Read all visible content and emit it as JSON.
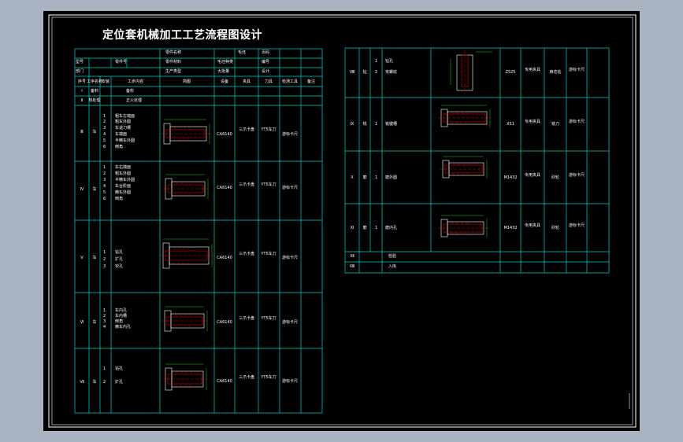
{
  "title": "定位套机械加工工艺流程图设计",
  "colors": {
    "background": "#a9b3c1",
    "sheet": "#000000",
    "border": "#ffffff",
    "grid": "#00d0d0",
    "part": "#e00000",
    "dimension": "#22cc22",
    "text": "#ffffff"
  },
  "header": {
    "row1": [
      "零件名称",
      "零件材料",
      "毛坯",
      "页码"
    ],
    "row2": [
      "型号",
      "零件号",
      "毛坯种类",
      "编号"
    ],
    "row3": [
      "部门",
      "生产类型",
      "大批量",
      "设计"
    ]
  },
  "column_headers": [
    "序号",
    "工序名称",
    "安装",
    "工步内容",
    "简图",
    "设备",
    "夹具",
    "刀具",
    "检测工具",
    "备注"
  ],
  "left_rows": [
    {
      "seq": "Ⅰ",
      "name": "备料",
      "content": "备料"
    },
    {
      "seq": "Ⅱ",
      "name": "热处理",
      "content": "正火处理"
    },
    {
      "seq": "Ⅲ",
      "name": "车",
      "install": "1",
      "steps": [
        "粗车左端面",
        "粗车外圆",
        "车退刀槽",
        "车端面",
        "半精车外圆",
        "倒角"
      ],
      "machine": "CA6140",
      "fixture": "三爪卡盘",
      "tool": "YT5车刀",
      "gauge": "游标卡尺"
    },
    {
      "seq": "Ⅳ",
      "name": "车",
      "install": "1",
      "steps": [
        "车右端面",
        "粗车外圆",
        "半精车外圆",
        "车台阶面",
        "精车外圆",
        "倒角"
      ],
      "machine": "CA6140",
      "fixture": "三爪卡盘",
      "tool": "YT5车刀",
      "gauge": "游标卡尺"
    },
    {
      "seq": "Ⅴ",
      "name": "车",
      "install": "1",
      "steps": [
        "钻孔",
        "扩孔",
        "铰孔"
      ],
      "machine": "CA6140",
      "fixture": "三爪卡盘",
      "tool": "YT5车刀",
      "gauge": "游标卡尺"
    },
    {
      "seq": "Ⅵ",
      "name": "车",
      "install": "1",
      "steps": [
        "车内孔",
        "车内槽",
        "倒角",
        "精车内孔"
      ],
      "machine": "CA6140",
      "fixture": "三爪卡盘",
      "tool": "YT5车刀",
      "gauge": "游标卡尺"
    },
    {
      "seq": "Ⅶ",
      "name": "车",
      "install": "1",
      "steps": [
        "钻孔",
        "扩孔"
      ],
      "machine": "CA6140",
      "fixture": "三爪卡盘",
      "tool": "YT5车刀",
      "gauge": "游标卡尺"
    }
  ],
  "right_rows": [
    {
      "seq": "Ⅷ",
      "name": "钻",
      "install": "1",
      "steps": [
        "钻孔",
        "攻螺纹"
      ],
      "machine": "Z525",
      "fixture": "专用夹具",
      "tool": "麻花钻",
      "gauge": "游标卡尺"
    },
    {
      "seq": "Ⅸ",
      "name": "铣",
      "install": "1",
      "steps": [
        "铣键槽"
      ],
      "machine": "X51",
      "fixture": "专用夹具",
      "tool": "铣刀",
      "gauge": "游标卡尺"
    },
    {
      "seq": "Ⅹ",
      "name": "磨",
      "install": "1",
      "steps": [
        "磨外圆"
      ],
      "machine": "M1432",
      "fixture": "专用夹具",
      "tool": "砂轮",
      "gauge": "游标卡尺"
    },
    {
      "seq": "Ⅺ",
      "name": "磨",
      "install": "1",
      "steps": [
        "磨内孔"
      ],
      "machine": "M1432",
      "fixture": "专用夹具",
      "tool": "砂轮",
      "gauge": "游标卡尺"
    },
    {
      "seq": "Ⅻ",
      "content": "检验"
    },
    {
      "seq": "ⅩⅢ",
      "content": "入库"
    }
  ]
}
